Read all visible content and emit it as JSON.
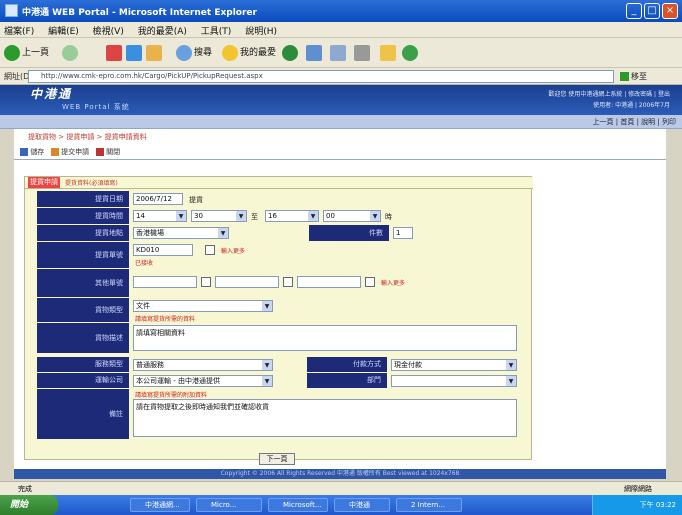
{
  "window": {
    "title": "中港通 WEB Portal - Microsoft Internet Explorer",
    "min": "_",
    "max": "□",
    "close": "×"
  },
  "menubar": {
    "items": [
      "檔案(F)",
      "編輯(E)",
      "檢視(V)",
      "我的最愛(A)",
      "工具(T)",
      "說明(H)"
    ]
  },
  "toolbar": {
    "back": "上一頁",
    "search": "搜尋",
    "favorites": "我的最愛"
  },
  "address": {
    "label": "網址(D)",
    "url": "http://www.cmk-epro.com.hk/Cargo/PickUP/PickupRequest.aspx",
    "go": "移至"
  },
  "site": {
    "logo": "中港通",
    "subtitle": "WEB Portal 系統",
    "top_right_1": "歡迎您 使用中港通網上系統 | 修改密碼 | 登出",
    "top_right_2": "使用者: 中港通 | 2006年7月"
  },
  "navstrip": {
    "right_links": "上一頁 | 首頁 | 說明 | 列印"
  },
  "content": {
    "breadcrumb": "提取貨物 > 提貨申請 > 提貨申請資料",
    "actions": [
      "儲存",
      "提交申請",
      "關閉"
    ]
  },
  "form": {
    "tab_title": "提貨申請",
    "tab_subtitle": "提貨資料(必須填寫)",
    "rows": {
      "date_label": "提貨日期",
      "date_value": "2006/7/12",
      "date_hint": "提貨",
      "time_label": "提貨時間",
      "time_h1": "14",
      "time_m1": "30",
      "time_sep": "至",
      "time_h2": "16",
      "time_m2": "00",
      "time_unit": "時",
      "location_label": "提貨地點",
      "location_value": "香港機場",
      "qty_label": "件數",
      "qty_value": "1",
      "cargo_label": "提貨單號",
      "cargo_value": "KD010",
      "cargo_add": "輸入更多",
      "cargo_note": "已接收",
      "extra_label": "其他單號",
      "extra_add": "輸入更多",
      "type_label": "貨物類型",
      "type_value": "文件",
      "type_note": "請填寫提貨所需的資料",
      "desc_label": "貨物描述",
      "desc_value": "請填寫相關資料",
      "service_label": "服務類型",
      "service_value": "普通服務",
      "pay_label": "付款方式",
      "pay_value": "現金付款",
      "carrier_label": "運輸公司",
      "carrier_value": "本公司運輸 - 由中港通提供",
      "dept_label": "部門",
      "dept_value": "",
      "remark_label": "備註",
      "remark_note": "請填寫提貨所需的附加資料",
      "remark_value": "請在貨物提取之後即時通知我們並確認收貨",
      "next_button": "下一頁"
    }
  },
  "footer": {
    "text": "Copyright © 2006 All Rights Reserved 中港通 版權所有 Best viewed at 1024x768"
  },
  "statusbar": {
    "left": "完成",
    "right": "網際網路"
  },
  "taskbar": {
    "start": "開始",
    "tasks": [
      "中港通網...",
      "Micro...",
      "Microsoft...",
      "中港通",
      "2 Intern..."
    ],
    "clock": "下午 03:22"
  }
}
